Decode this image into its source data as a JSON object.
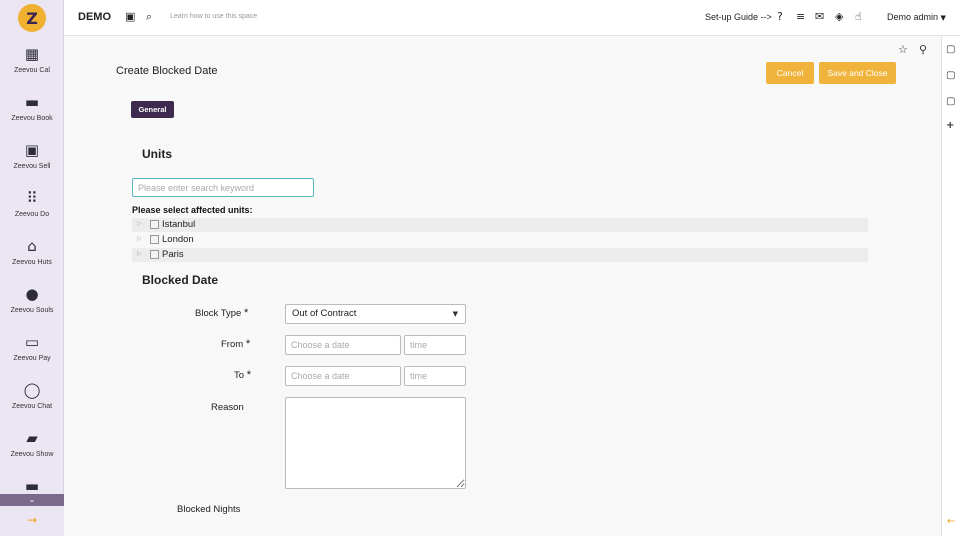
{
  "app": {
    "brand": "DEMO",
    "hint": "Learn how to use this space",
    "guide": "Set-up Guide -->",
    "user": "Demo admin"
  },
  "sidebar": {
    "items": [
      {
        "label": "Zeevou Cal",
        "icon": "calendar-icon"
      },
      {
        "label": "Zeevou Book",
        "icon": "bed-icon"
      },
      {
        "label": "Zeevou Sell",
        "icon": "money-icon"
      },
      {
        "label": "Zeevou Do",
        "icon": "grid-icon"
      },
      {
        "label": "Zeevou Huts",
        "icon": "home-icon"
      },
      {
        "label": "Zeevou Souls",
        "icon": "user-icon"
      },
      {
        "label": "Zeevou Pay",
        "icon": "credit-card-icon"
      },
      {
        "label": "Zeevou Chat",
        "icon": "chat-icon"
      },
      {
        "label": "Zeevou Show",
        "icon": "book-icon"
      },
      {
        "label": "",
        "icon": "folder-icon"
      }
    ]
  },
  "page": {
    "title": "Create Blocked Date",
    "cancel_label": "Cancel",
    "save_label": "Save and Close",
    "tab_general": "General"
  },
  "units": {
    "heading": "Units",
    "search_placeholder": "Please enter search keyword",
    "select_label": "Please select affected units:",
    "list": [
      "Istanbul",
      "London",
      "Paris"
    ]
  },
  "blocked": {
    "heading": "Blocked Date",
    "block_type_label": "Block Type",
    "block_type_value": "Out of Contract",
    "from_label": "From",
    "to_label": "To",
    "date_placeholder": "Choose a date",
    "time_placeholder": "time",
    "reason_label": "Reason",
    "nights_label": "Blocked Nights",
    "required_mark": "*"
  }
}
